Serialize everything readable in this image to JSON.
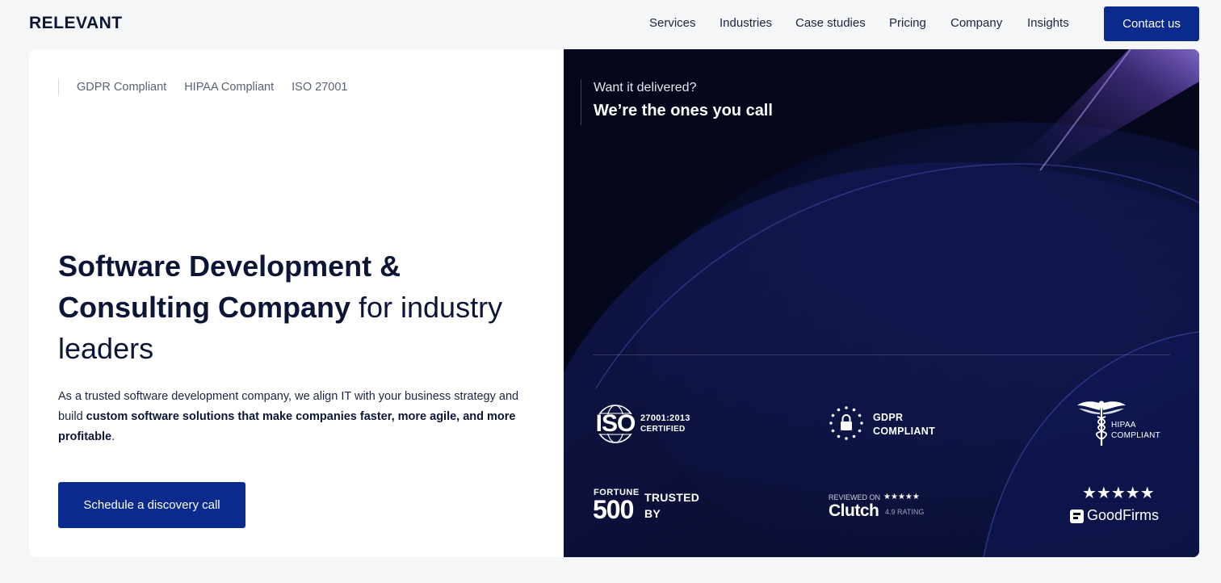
{
  "header": {
    "logo": "RELEVANT",
    "nav": [
      "Services",
      "Industries",
      "Case studies",
      "Pricing",
      "Company",
      "Insights"
    ],
    "contact_label": "Contact us"
  },
  "hero": {
    "compliance": [
      "GDPR Compliant",
      "HIPAA Compliant",
      "ISO 27001"
    ],
    "headline_strong": "Software Development & Consulting Company",
    "headline_light": " for industry leaders",
    "desc_plain_1": "As a trusted software development company, we align IT with your business strategy and build ",
    "desc_strong": "custom software solutions that make companies faster, more agile, and more profitable",
    "desc_plain_2": ".",
    "cta_label": "Schedule a discovery call"
  },
  "panel": {
    "tagline_small": "Want it delivered?",
    "tagline_big": "We’re the ones you call",
    "badges": {
      "iso": {
        "logo": "ISO",
        "line1": "27001:2013",
        "line2": "CERTIFIED"
      },
      "gdpr": {
        "line1": "GDPR",
        "line2": "COMPLIANT"
      },
      "hipaa": {
        "line1": "HIPAA",
        "line2": "COMPLIANT"
      },
      "fortune": {
        "logo1": "FORTUNE",
        "logo2": "500",
        "line1": "TRUSTED",
        "line2": "BY"
      },
      "clutch": {
        "reviewed": "REVIEWED ON",
        "stars": "★★★★★",
        "logo": "Clutch",
        "rating": "4.9 RATING"
      },
      "goodfirms": {
        "stars": "★★★★★",
        "logo": "GoodFirms"
      }
    }
  },
  "colors": {
    "brand_blue": "#0b2a8e",
    "navy_text": "#0c1535",
    "panel_bg": "#070a1e"
  }
}
